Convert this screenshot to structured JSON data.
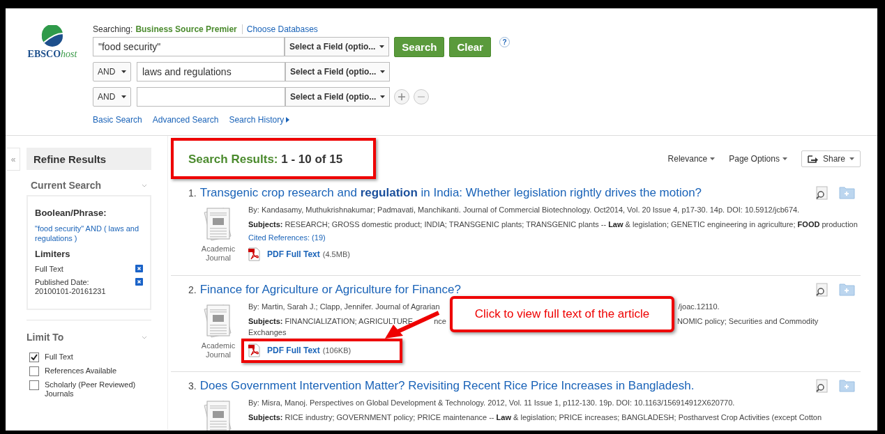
{
  "logo": {
    "brand": "EBSCO",
    "suffix": "host"
  },
  "search": {
    "searching_label": "Searching:",
    "database": "Business Source Premier",
    "choose_databases": "Choose Databases",
    "rows": [
      {
        "kind": "first",
        "value": "\"food security\"",
        "field": "Select a Field (optio..."
      },
      {
        "kind": "bool",
        "operator": "AND",
        "value": "laws and regulations",
        "field": "Select a Field (optio..."
      },
      {
        "kind": "bool-add",
        "operator": "AND",
        "field": "Select a Field (optio..."
      }
    ],
    "buttons": [
      "Search",
      "Clear"
    ],
    "help": "?",
    "links": [
      {
        "label": "Basic Search"
      },
      {
        "label": "Advanced Search"
      },
      {
        "label": "Search History"
      }
    ]
  },
  "sidebar": {
    "collapse": "«",
    "title": "Refine Results",
    "current_search": {
      "title": "Current Search",
      "boolean_label": "Boolean/Phrase:",
      "query": "\"food security\" AND ( laws and regulations )",
      "limiters_title": "Limiters",
      "limiters": [
        {
          "label": "Full Text"
        },
        {
          "label": "Published Date: 20100101-20161231"
        }
      ]
    },
    "limit_to": {
      "title": "Limit To",
      "options": [
        {
          "label": "Full Text",
          "checked": true
        },
        {
          "label": "References Available",
          "checked": false
        },
        {
          "label": "Scholarly (Peer Reviewed) Journals",
          "checked": false
        }
      ]
    }
  },
  "results_heading": {
    "label": "Search Results:",
    "range": "1 - 10 of 15",
    "highlighted": true
  },
  "toolbar": {
    "sort": "Relevance",
    "page_options": "Page Options",
    "share": "Share"
  },
  "results": [
    {
      "number": "1.",
      "title": "Transgenic crop research and **regulation** in India: Whether legislation rightly drives the motion?",
      "byline": [
        "By: Kandasamy, Muthukrishnakumar; Padmavati, Manchikanti. Journal of Commercial Biotechnology. Oct2014, Vol. 20 Issue 4, p17-30. 14p. DOI: 10.5912/jcb674."
      ],
      "subjects": [
        "**Subjects:** RESEARCH; GROSS domestic product; INDIA; TRANSGENIC plants; TRANSGENIC plants -- **Law** & legislation; GENETIC engineering in agriculture; **FOOD** production"
      ],
      "type": "Academic Journal",
      "cited": "Cited References: (19)",
      "pdf": {
        "label": "PDF Full Text",
        "size": "(4.5MB)",
        "highlighted": false
      }
    },
    {
      "number": "2.",
      "title": "Finance for Agriculture or Agriculture for Finance?",
      "byline": [
        "By: Martin, Sarah J.; Clapp, Jennifer. Journal of Agrarian",
        "/joac.12110."
      ],
      "subjects": [
        "**Subjects:** FINANCIALIZATION; AGRICULTURE",
        "nce",
        "NOMIC policy; Securities and Commodity"
      ],
      "subjects_more": "Exchanges",
      "type": "Academic Journal",
      "pdf": {
        "label": "PDF Full Text",
        "size": "(106KB)",
        "highlighted": true
      },
      "callout": {
        "text": "Click to view full text of the article"
      }
    },
    {
      "number": "3.",
      "title": "Does Government Intervention Matter? Revisiting Recent Rice Price Increases in Bangladesh.",
      "byline": [
        "By: Misra, Manoj. Perspectives on Global Development & Technology. 2012, Vol. 11 Issue 1, p112-130. 19p. DOI: 10.1163/156914912X620770."
      ],
      "subjects": [
        "**Subjects:** RICE industry; GOVERNMENT policy; PRICE maintenance -- **Law** & legislation; PRICE increases; BANGLADESH; Postharvest Crop Activities (except Cotton"
      ]
    }
  ]
}
